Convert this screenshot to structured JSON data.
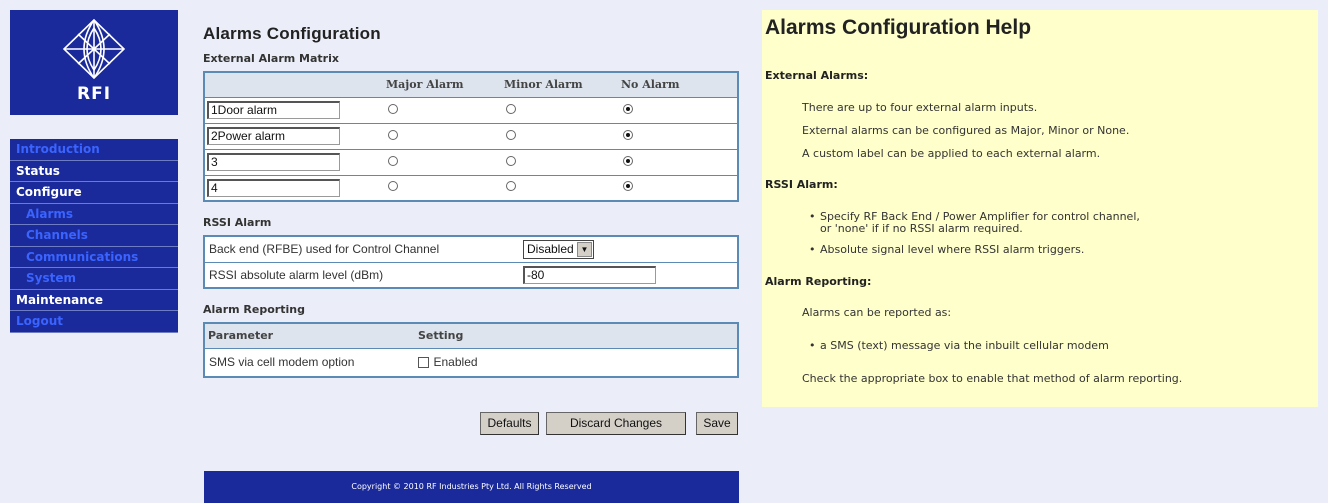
{
  "brand": "RFI",
  "nav": [
    {
      "label": "Introduction",
      "level": 0,
      "link": true
    },
    {
      "label": "Status",
      "level": 0,
      "link": false
    },
    {
      "label": "Configure",
      "level": 0,
      "link": false
    },
    {
      "label": "Alarms",
      "level": 1,
      "link": true
    },
    {
      "label": "Channels",
      "level": 1,
      "link": true
    },
    {
      "label": "Communications",
      "level": 1,
      "link": true
    },
    {
      "label": "System",
      "level": 1,
      "link": true
    },
    {
      "label": "Maintenance",
      "level": 0,
      "link": false
    },
    {
      "label": "Logout",
      "level": 0,
      "link": true
    }
  ],
  "page_title": "Alarms Configuration",
  "external": {
    "title": "External Alarm Matrix",
    "headers": [
      "Major Alarm",
      "Minor Alarm",
      "No Alarm"
    ],
    "rows": [
      {
        "label": "1Door alarm",
        "selected": "none"
      },
      {
        "label": "2Power alarm",
        "selected": "none"
      },
      {
        "label": "3",
        "selected": "none"
      },
      {
        "label": "4",
        "selected": "none"
      }
    ]
  },
  "rssi": {
    "title": "RSSI Alarm",
    "backend_label": "Back end (RFBE) used for Control Channel",
    "backend_value": "Disabled",
    "level_label": "RSSI absolute alarm level (dBm)",
    "level_value": "-80"
  },
  "reporting": {
    "title": "Alarm Reporting",
    "col_parameter": "Parameter",
    "col_setting": "Setting",
    "sms_label": "SMS via cell modem option",
    "sms_checkbox_label": "Enabled",
    "sms_checked": false
  },
  "buttons": {
    "defaults": "Defaults",
    "discard": "Discard Changes",
    "save": "Save"
  },
  "footer": "Copyright © 2010 RF Industries Pty Ltd. All Rights Reserved",
  "help": {
    "title": "Alarms Configuration Help",
    "external_heading": "External Alarms:",
    "external_p1": "There are up to four external alarm inputs.",
    "external_p2": "External alarms can be configured as Major, Minor or None.",
    "external_p3": "A custom label can be applied to each external alarm.",
    "rssi_heading": "RSSI Alarm:",
    "rssi_li1": "Specify RF Back End / Power Amplifier for control channel, or 'none' if if no RSSI alarm required.",
    "rssi_li2": "Absolute signal level where RSSI alarm triggers.",
    "reporting_heading": "Alarm Reporting:",
    "reporting_p1": "Alarms can be reported as:",
    "reporting_li1": "a SMS (text) message via the inbuilt cellular modem",
    "reporting_p2": "Check the appropriate box to enable that method of alarm reporting."
  },
  "colors": {
    "nav_bg": "#1a2a9a",
    "nav_link": "#3a63ff",
    "table_border": "#5b8ab5",
    "help_bg": "#ffffcc",
    "page_bg": "#ebeef8"
  }
}
